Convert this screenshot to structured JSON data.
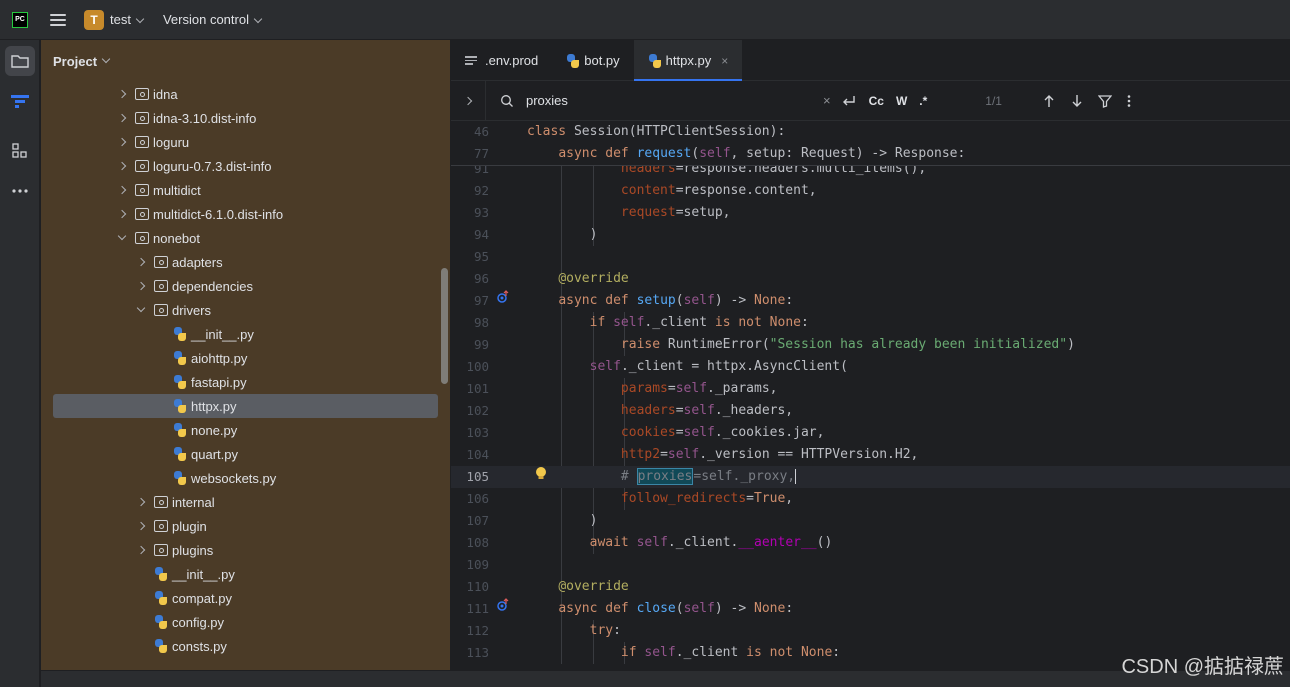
{
  "titlebar": {
    "logo_text": "PC",
    "project_initial": "T",
    "project_name": "test",
    "vcs_label": "Version control"
  },
  "toolstrip": {
    "items": [
      "folder-icon",
      "commit-icon",
      "structure-icon",
      "more-icon"
    ]
  },
  "project_panel": {
    "title": "Project",
    "rows": [
      {
        "label": "idna",
        "kind": "folder",
        "depth": 0,
        "state": "collapsed"
      },
      {
        "label": "idna-3.10.dist-info",
        "kind": "folder",
        "depth": 0,
        "state": "collapsed"
      },
      {
        "label": "loguru",
        "kind": "folder",
        "depth": 0,
        "state": "collapsed"
      },
      {
        "label": "loguru-0.7.3.dist-info",
        "kind": "folder",
        "depth": 0,
        "state": "collapsed"
      },
      {
        "label": "multidict",
        "kind": "folder",
        "depth": 0,
        "state": "collapsed"
      },
      {
        "label": "multidict-6.1.0.dist-info",
        "kind": "folder",
        "depth": 0,
        "state": "collapsed"
      },
      {
        "label": "nonebot",
        "kind": "folder",
        "depth": 0,
        "state": "expanded"
      },
      {
        "label": "adapters",
        "kind": "folder",
        "depth": 1,
        "state": "collapsed"
      },
      {
        "label": "dependencies",
        "kind": "folder",
        "depth": 1,
        "state": "collapsed"
      },
      {
        "label": "drivers",
        "kind": "folder",
        "depth": 1,
        "state": "expanded"
      },
      {
        "label": "__init__.py",
        "kind": "py",
        "depth": 2
      },
      {
        "label": "aiohttp.py",
        "kind": "py",
        "depth": 2
      },
      {
        "label": "fastapi.py",
        "kind": "py",
        "depth": 2
      },
      {
        "label": "httpx.py",
        "kind": "py",
        "depth": 2,
        "selected": true
      },
      {
        "label": "none.py",
        "kind": "py",
        "depth": 2
      },
      {
        "label": "quart.py",
        "kind": "py",
        "depth": 2
      },
      {
        "label": "websockets.py",
        "kind": "py",
        "depth": 2
      },
      {
        "label": "internal",
        "kind": "folder",
        "depth": 1,
        "state": "collapsed"
      },
      {
        "label": "plugin",
        "kind": "folder",
        "depth": 1,
        "state": "collapsed"
      },
      {
        "label": "plugins",
        "kind": "folder",
        "depth": 1,
        "state": "collapsed"
      },
      {
        "label": "__init__.py",
        "kind": "py",
        "depth": 1
      },
      {
        "label": "compat.py",
        "kind": "py",
        "depth": 1
      },
      {
        "label": "config.py",
        "kind": "py",
        "depth": 1
      },
      {
        "label": "consts.py",
        "kind": "py",
        "depth": 1
      }
    ]
  },
  "editor": {
    "tabs": [
      {
        "label": ".env.prod",
        "icon": "text-file-icon",
        "active": false
      },
      {
        "label": "bot.py",
        "icon": "python-file-icon",
        "active": false
      },
      {
        "label": "httpx.py",
        "icon": "python-file-icon",
        "active": true,
        "close": "×"
      }
    ],
    "find": {
      "query": "proxies",
      "clear": "×",
      "opt_case": "Cc",
      "opt_word": "W",
      "opt_regex": ".*",
      "count": "1/1"
    },
    "sticky_lines": [
      {
        "n": "46",
        "html": "<span class=\"kw\">class</span> Session(HTTPClientSession):"
      },
      {
        "n": "77",
        "html": "    <span class=\"kw\">async def</span> <span class=\"fn\">request</span>(<span class=\"sf\">self</span>, setup: Request) -> Response:"
      }
    ],
    "lines": [
      {
        "n": "91",
        "html": "            <span class=\"param\">headers</span>=response.headers.multi_items(),"
      },
      {
        "n": "92",
        "html": "            <span class=\"param\">content</span>=response.content,"
      },
      {
        "n": "93",
        "html": "            <span class=\"param\">request</span>=setup,"
      },
      {
        "n": "94",
        "html": "        )"
      },
      {
        "n": "95",
        "html": ""
      },
      {
        "n": "96",
        "html": "    <span class=\"dec\">@override</span>"
      },
      {
        "n": "97",
        "html": "    <span class=\"kw\">async def</span> <span class=\"fn\">setup</span>(<span class=\"sf\">self</span>) -> <span class=\"kw\">None</span>:",
        "gutter": "override"
      },
      {
        "n": "98",
        "html": "        <span class=\"kw\">if</span> <span class=\"sf\">self</span>._client <span class=\"kw\">is not</span> <span class=\"kw\">None</span>:"
      },
      {
        "n": "99",
        "html": "            <span class=\"kw\">raise</span> <span class=\"cls\">RuntimeError</span>(<span class=\"str\">\"Session has already been initialized\"</span>)"
      },
      {
        "n": "100",
        "html": "        <span class=\"sf\">self</span>._client = httpx.AsyncClient("
      },
      {
        "n": "101",
        "html": "            <span class=\"param\">params</span>=<span class=\"sf\">self</span>._params,"
      },
      {
        "n": "102",
        "html": "            <span class=\"param\">headers</span>=<span class=\"sf\">self</span>._headers,"
      },
      {
        "n": "103",
        "html": "            <span class=\"param\">cookies</span>=<span class=\"sf\">self</span>._cookies.jar,"
      },
      {
        "n": "104",
        "html": "            <span class=\"param\">http2</span>=<span class=\"sf\">self</span>._version == HTTPVersion.H2,"
      },
      {
        "n": "105",
        "html": "            <span class=\"cmt\"># <span class=\"hl\">proxies</span>=self._proxy,</span><span class=\"caret\"></span>",
        "current": true,
        "gutter": "bulb"
      },
      {
        "n": "106",
        "html": "            <span class=\"param\">follow_redirects</span>=<span class=\"kw\">True</span>,"
      },
      {
        "n": "107",
        "html": "        )"
      },
      {
        "n": "108",
        "html": "        <span class=\"kw\">await</span> <span class=\"sf\">self</span>._client.<span class=\"dunder\">__aenter__</span>()"
      },
      {
        "n": "109",
        "html": ""
      },
      {
        "n": "110",
        "html": "    <span class=\"dec\">@override</span>"
      },
      {
        "n": "111",
        "html": "    <span class=\"kw\">async def</span> <span class=\"fn\">close</span>(<span class=\"sf\">self</span>) -> <span class=\"kw\">None</span>:",
        "gutter": "override"
      },
      {
        "n": "112",
        "html": "        <span class=\"kw\">try</span>:"
      },
      {
        "n": "113",
        "html": "            <span class=\"kw\">if</span> <span class=\"sf\">self</span>._client <span class=\"kw\">is not</span> <span class=\"kw\">None</span>:"
      }
    ]
  },
  "watermark": "CSDN @掂掂禄蔗"
}
